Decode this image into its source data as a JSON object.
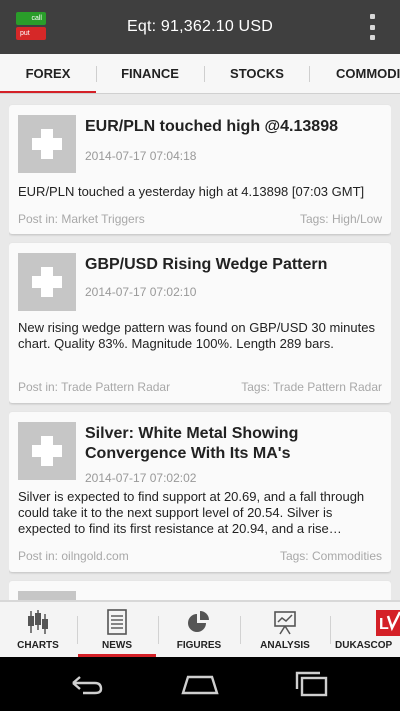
{
  "header": {
    "logo_call": "call",
    "logo_put": "put",
    "equity": "Eqt: 91,362.10 USD"
  },
  "tabs": [
    {
      "label": "FOREX",
      "active": true
    },
    {
      "label": "FINANCE",
      "active": false
    },
    {
      "label": "STOCKS",
      "active": false
    },
    {
      "label": "COMMODI",
      "active": false
    }
  ],
  "news": [
    {
      "title": "EUR/PLN touched high @4.13898",
      "date": "2014-07-17 07:04:18",
      "body": "EUR/PLN touched a yesterday high at 4.13898 [07:03 GMT]",
      "post": "Post in: Market Triggers",
      "tags": "Tags: High/Low"
    },
    {
      "title": "GBP/USD Rising Wedge Pattern",
      "date": "2014-07-17 07:02:10",
      "body": "New rising wedge pattern was found on GBP/USD 30 minutes chart. Quality 83%. Magnitude 100%. Length 289 bars.",
      "post": "Post in: Trade Pattern Radar",
      "tags": "Tags: Trade Pattern Radar"
    },
    {
      "title": "Silver: White Metal Showing Convergence With Its MA's",
      "date": "2014-07-17 07:02:02",
      "body": "Silver is expected to find support at 20.69, and a fall through could take it to the next support level of 20.54. Silver is expected to find its first resistance at 20.94, and a rise…",
      "post": "Post in: oilngold.com",
      "tags": "Tags: Commodities"
    }
  ],
  "bottom_nav": [
    {
      "label": "CHARTS",
      "icon": "candlestick-chart-icon",
      "active": false
    },
    {
      "label": "NEWS",
      "icon": "newspaper-icon",
      "active": true
    },
    {
      "label": "FIGURES",
      "icon": "pie-chart-icon",
      "active": false
    },
    {
      "label": "ANALYSIS",
      "icon": "presentation-board-icon",
      "active": false
    },
    {
      "label": "DUKASCOP",
      "icon": "dukascopy-logo-icon",
      "active": false
    }
  ],
  "colors": {
    "accent": "#d42027",
    "topbar": "#3f3f3f",
    "call_green": "#2a9d2a",
    "put_red": "#d62828"
  }
}
